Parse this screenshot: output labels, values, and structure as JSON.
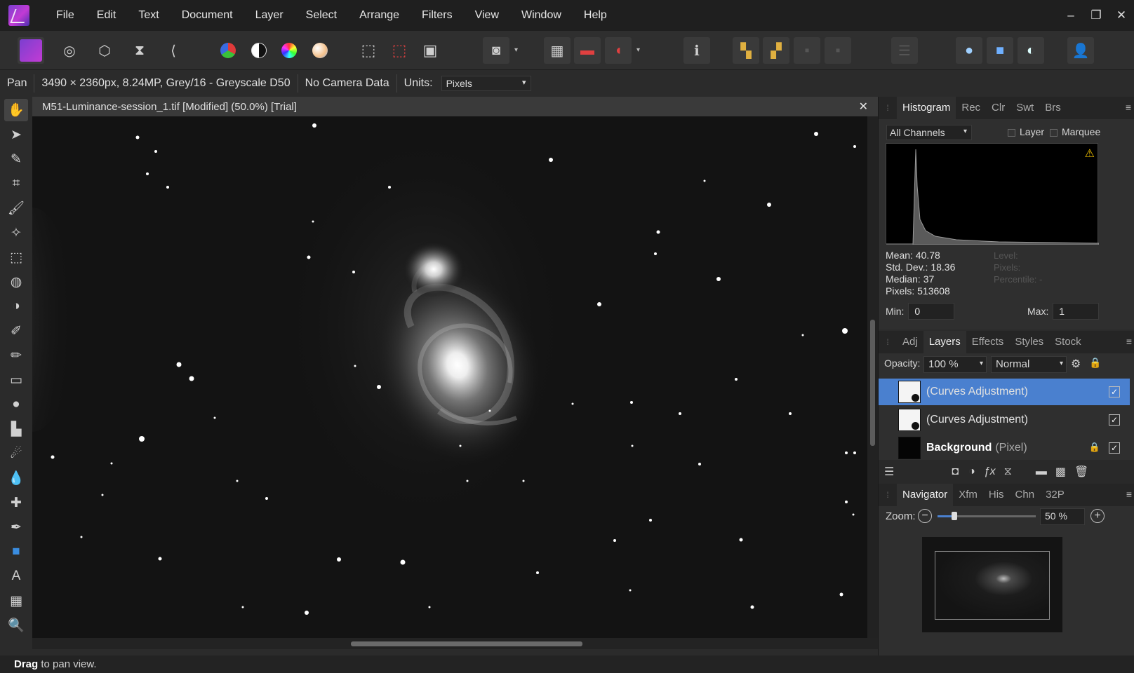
{
  "menubar": {
    "items": [
      "File",
      "Edit",
      "Text",
      "Document",
      "Layer",
      "Select",
      "Arrange",
      "Filters",
      "View",
      "Window",
      "Help"
    ],
    "window_controls": [
      "–",
      "❐",
      "✕"
    ]
  },
  "context": {
    "tool_name": "Pan",
    "image_info": "3490 × 2360px, 8.24MP, Grey/16 - Greyscale D50",
    "camera": "No Camera Data",
    "units_label": "Units:",
    "units_value": "Pixels"
  },
  "document": {
    "tab_title": "M51-Luminance-session_1.tif [Modified] (50.0%) [Trial]",
    "close_glyph": "✕"
  },
  "histogram_panel": {
    "tabs": [
      "Histogram",
      "Rec",
      "Clr",
      "Swt",
      "Brs"
    ],
    "channel_select": "All Channels",
    "layer_label": "Layer",
    "marquee_label": "Marquee",
    "warning_icon": "⚠",
    "stats": {
      "mean": "Mean: 40.78",
      "std_dev": "Std. Dev.: 18.36",
      "median": "Median: 37",
      "pixels": "Pixels: 513608"
    },
    "ghost_stats": {
      "level": "Level:",
      "pixels": "Pixels:",
      "percentile": "Percentile: -"
    },
    "min_label": "Min:",
    "min_value": "0",
    "max_label": "Max:",
    "max_value": "1"
  },
  "layers_panel": {
    "tabs": [
      "Adj",
      "Layers",
      "Effects",
      "Styles",
      "Stock"
    ],
    "opacity_label": "Opacity:",
    "opacity_value": "100 %",
    "blend_mode": "Normal",
    "layers": [
      {
        "name": "(Curves Adjustment)",
        "kind": "",
        "selected": true
      },
      {
        "name": "(Curves Adjustment)",
        "kind": "",
        "selected": false
      },
      {
        "name": "Background",
        "kind": "(Pixel)",
        "selected": false,
        "locked": true
      }
    ]
  },
  "navigator_panel": {
    "tabs": [
      "Navigator",
      "Xfm",
      "His",
      "Chn",
      "32P"
    ],
    "zoom_label": "Zoom:",
    "zoom_value": "50 %",
    "zoom_slider_fraction": 0.17
  },
  "status": {
    "bold": "Drag",
    "text": " to pan view."
  }
}
